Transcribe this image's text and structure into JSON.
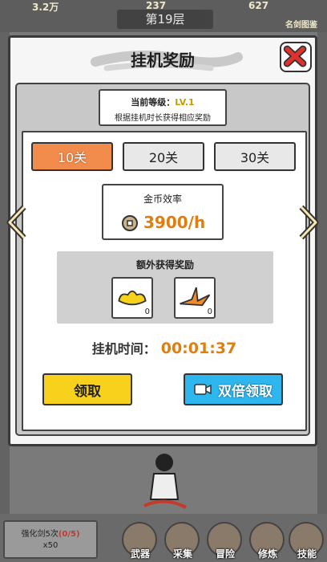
{
  "background": {
    "top_stats": [
      "3.2万",
      "237",
      "627"
    ],
    "floor_label": "第19层",
    "top_right_label": "名剑图鉴",
    "quest": {
      "text": "强化剑5次",
      "progress": "(0/5)",
      "reward": "x50"
    },
    "bottom_tabs": [
      {
        "label": "武器"
      },
      {
        "label": "采集"
      },
      {
        "label": "冒险"
      },
      {
        "label": "修炼"
      },
      {
        "label": "技能"
      }
    ]
  },
  "dialog": {
    "title": "挂机奖励",
    "level_prefix": "当前等级：",
    "level_value": "LV.1",
    "level_desc": "根据挂机时长获得相应奖励",
    "tabs": [
      {
        "label": "10关",
        "active": true
      },
      {
        "label": "20关",
        "active": false
      },
      {
        "label": "30关",
        "active": false
      }
    ],
    "gold_rate_label": "金币效率",
    "gold_rate_value": "3900/h",
    "extra_rewards_label": "额外获得奖励",
    "extra_rewards": [
      {
        "icon": "gold-ingot-icon",
        "count": "0"
      },
      {
        "icon": "origami-crane-icon",
        "count": "0"
      }
    ],
    "time_label": "挂机时间：",
    "time_value": "00:01:37",
    "claim_label": "领取",
    "double_claim_label": "双倍领取"
  },
  "colors": {
    "accent_orange": "#f28c4c",
    "gold_text": "#e07e10",
    "claim_yellow": "#f7d11c",
    "double_blue": "#2eb7ef",
    "close_red": "#e0322d"
  }
}
